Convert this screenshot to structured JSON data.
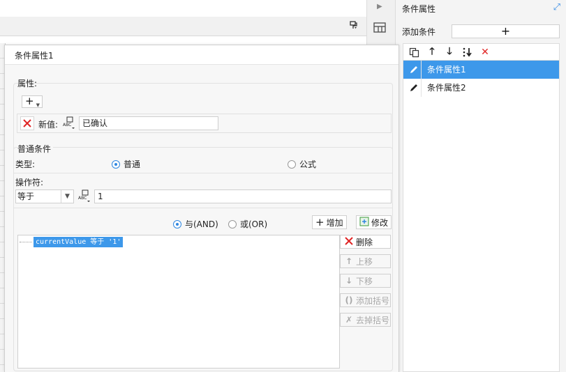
{
  "right_panel": {
    "title": "条件属性",
    "add_condition_label": "添加条件",
    "add_button": "+",
    "items": [
      {
        "label": "条件属性1",
        "selected": true
      },
      {
        "label": "条件属性2",
        "selected": false
      }
    ]
  },
  "dialog": {
    "title": "条件属性1",
    "attribute_section": "属性:",
    "new_value_label": "新值:",
    "new_value": "已确认",
    "common_condition_section": "普通条件",
    "type_label": "类型:",
    "type_options": [
      "普通",
      "公式"
    ],
    "type_selected": "普通",
    "operator_label": "操作符:",
    "operator_value": "等于",
    "operator_operand": "1",
    "logic_options": [
      "与(AND)",
      "或(OR)"
    ],
    "logic_selected": "与(AND)",
    "add_button": "增加",
    "modify_button": "修改",
    "conditions": [
      "currentValue 等于 '1'"
    ],
    "delete_button": "删除",
    "move_up_button": "上移",
    "move_down_button": "下移",
    "add_bracket_button": "添加括号",
    "remove_bracket_button": "去掉括号"
  },
  "colors": {
    "selection": "#3d98ea",
    "delete_red": "#e02424",
    "accent_blue": "#2f87e0"
  }
}
